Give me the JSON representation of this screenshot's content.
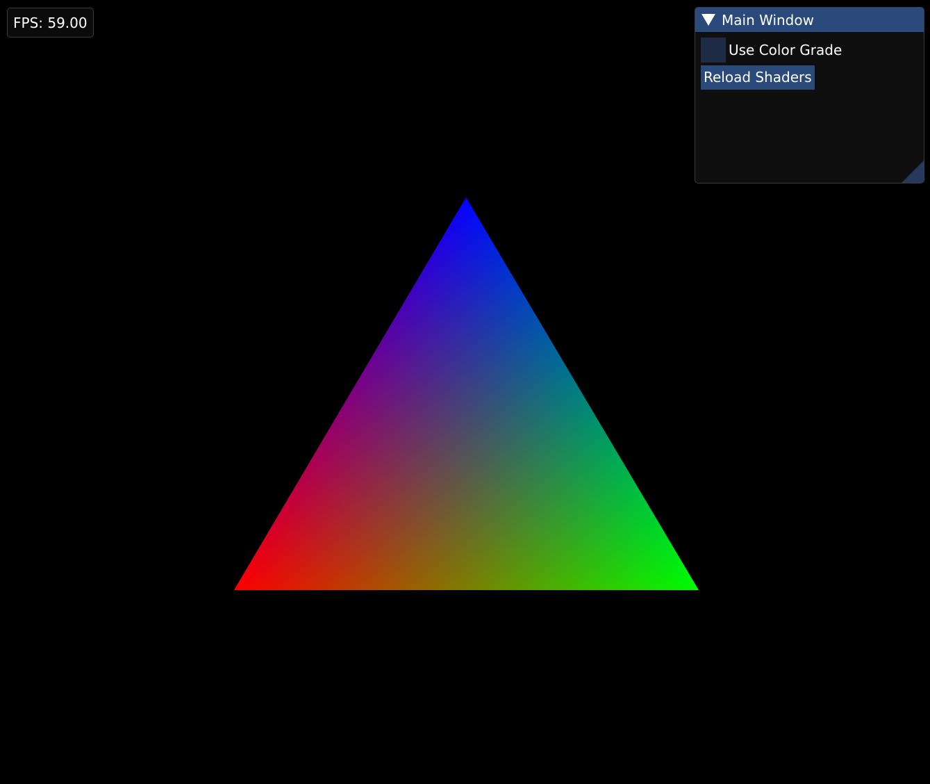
{
  "fps_overlay": {
    "text": "FPS: 59.00"
  },
  "main_window": {
    "title": "Main Window",
    "collapse_icon": "triangle-down",
    "checkbox": {
      "label": "Use Color Grade",
      "checked": false
    },
    "reload_button": {
      "label": "Reload Shaders"
    }
  },
  "scene": {
    "object": "triangle",
    "vertex_colors": {
      "top": "#0000ff",
      "bottom_left": "#ff0000",
      "bottom_right": "#00ff00"
    }
  },
  "colors": {
    "background": "#000000",
    "accent": "#294a7a",
    "checkbox_bg": "#1d2b45",
    "window_bg": "#0f0f0f"
  }
}
